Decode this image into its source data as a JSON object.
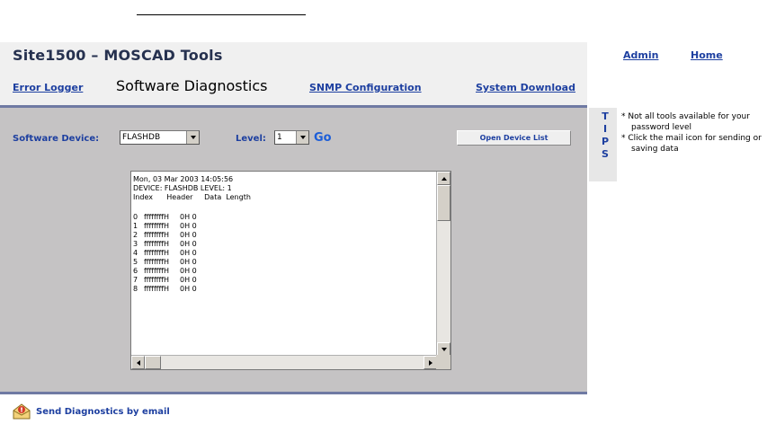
{
  "header": {
    "app_title": "Site1500 – MOSCAD Tools",
    "admin_link": "Admin",
    "home_link": "Home"
  },
  "nav": {
    "tabs": [
      {
        "label": "Error Logger",
        "active": false
      },
      {
        "label": "Software Diagnostics",
        "active": true
      },
      {
        "label": "SNMP Configuration",
        "active": false
      },
      {
        "label": "System Download",
        "active": false
      }
    ]
  },
  "controls": {
    "device_label": "Software Device:",
    "device_value": "FLASHDB",
    "level_label": "Level:",
    "level_value": "1",
    "go_label": "Go",
    "open_device_list_label": "Open Device List"
  },
  "log": {
    "timestamp": "Mon, 03 Mar 2003 14:05:56",
    "device_line": "DEVICE: FLASHDB  LEVEL: 1",
    "column_header": "Index      Header     Data  Length",
    "rows": [
      {
        "index": "0",
        "header": "ffffffffH",
        "data": "0H 0"
      },
      {
        "index": "1",
        "header": "ffffffffH",
        "data": "0H 0"
      },
      {
        "index": "2",
        "header": "ffffffffH",
        "data": "0H 0"
      },
      {
        "index": "3",
        "header": "ffffffffH",
        "data": "0H 0"
      },
      {
        "index": "4",
        "header": "ffffffffH",
        "data": "0H 0"
      },
      {
        "index": "5",
        "header": "ffffffffH",
        "data": "0H 0"
      },
      {
        "index": "6",
        "header": "ffffffffH",
        "data": "0H 0"
      },
      {
        "index": "7",
        "header": "ffffffffH",
        "data": "0H 0"
      },
      {
        "index": "8",
        "header": "ffffffffH",
        "data": "0H 0"
      }
    ]
  },
  "tips": {
    "letters": [
      "T",
      "I",
      "P",
      "S"
    ],
    "items": [
      "* Not all tools available for your password level",
      "* Click the mail icon for sending or saving data"
    ]
  },
  "footer": {
    "email_label": "Send Diagnostics by email"
  },
  "colors": {
    "link_blue": "#1d3fa0",
    "title_navy": "#26314f",
    "panel_gray": "#c5c3c4",
    "divider": "#6f7aa3"
  }
}
